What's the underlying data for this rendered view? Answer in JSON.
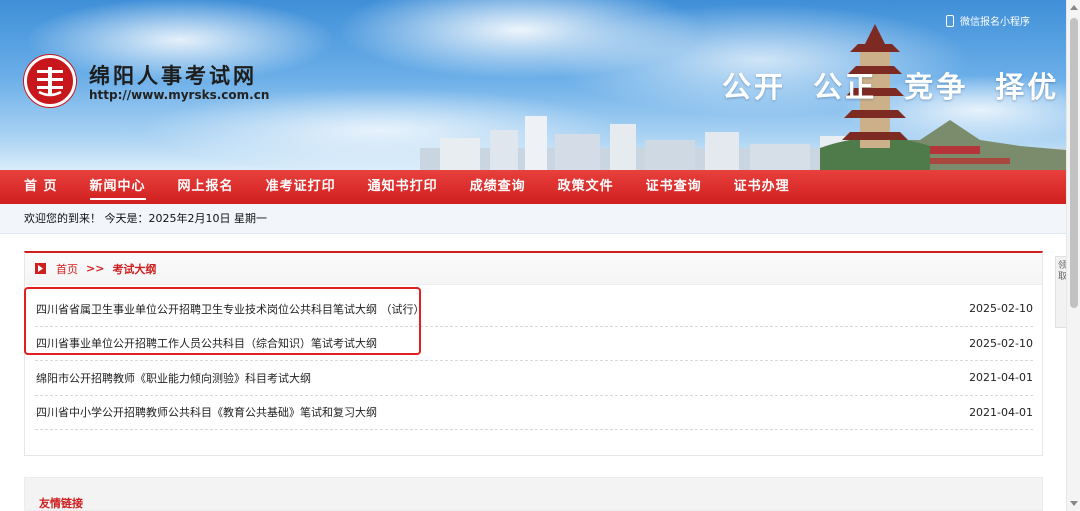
{
  "header": {
    "site_name": "绵阳人事考试网",
    "site_url": "http://www.myrsks.com.cn",
    "slogan": "公开  公正  竞争  择优",
    "mini_program": "微信报名小程序"
  },
  "nav": {
    "items": [
      {
        "label": "首 页"
      },
      {
        "label": "新闻中心",
        "active": true
      },
      {
        "label": "网上报名"
      },
      {
        "label": "准考证打印"
      },
      {
        "label": "通知书打印"
      },
      {
        "label": "成绩查询"
      },
      {
        "label": "政策文件"
      },
      {
        "label": "证书查询"
      },
      {
        "label": "证书办理"
      }
    ]
  },
  "welcome": {
    "text": "欢迎您的到来！ 今天是：2025年2月10日 星期一"
  },
  "breadcrumb": {
    "home": "首页",
    "separator": ">>",
    "current": "考试大纲"
  },
  "articles": [
    {
      "title": "四川省省属卫生事业单位公开招聘卫生专业技术岗位公共科目笔试大纲 （试行）",
      "date": "2025-02-10"
    },
    {
      "title": "四川省事业单位公开招聘工作人员公共科目（综合知识）笔试考试大纲",
      "date": "2025-02-10"
    },
    {
      "title": "绵阳市公开招聘教师《职业能力倾向测验》科目考试大纲",
      "date": "2021-04-01"
    },
    {
      "title": "四川省中小学公开招聘教师公共科目《教育公共基础》笔试和复习大纲",
      "date": "2021-04-01"
    }
  ],
  "friends": {
    "title": "友情链接"
  },
  "side_widget": {
    "text": "领取"
  },
  "colors": {
    "brand_red": "#cf1f1f",
    "highlight_red": "#e02020",
    "sky_blue": "#6aaee8"
  }
}
